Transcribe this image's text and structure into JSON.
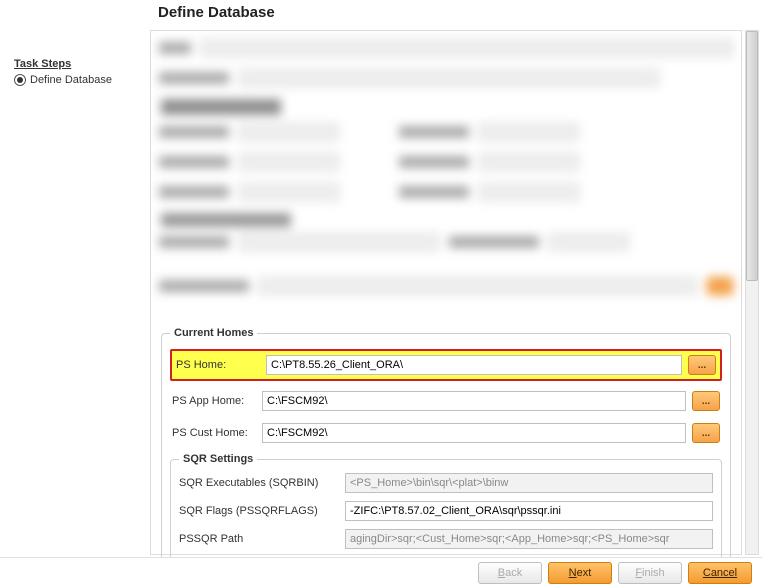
{
  "title": "Define Database",
  "sidebar": {
    "heading": "Task Steps",
    "items": [
      "Define Database"
    ],
    "selected": 0
  },
  "current_homes": {
    "legend": "Current Homes",
    "ps_home": {
      "label": "PS Home:",
      "value": "C:\\PT8.55.26_Client_ORA\\"
    },
    "ps_app_home": {
      "label": "PS App Home:",
      "value": "C:\\FSCM92\\"
    },
    "ps_cust_home": {
      "label": "PS Cust Home:",
      "value": "C:\\FSCM92\\"
    },
    "browse_label": "..."
  },
  "sqr": {
    "legend": "SQR Settings",
    "exec": {
      "label": "SQR Executables (SQRBIN)",
      "value": "<PS_Home>\\bin\\sqr\\<plat>\\binw"
    },
    "flags": {
      "label": "SQR Flags (PSSQRFLAGS)",
      "value": "-ZIFC:\\PT8.57.02_Client_ORA\\sqr\\pssqr.ini"
    },
    "path": {
      "label": "PSSQR Path",
      "value": "agingDir>sqr;<Cust_Home>sqr;<App_Home>sqr;<PS_Home>sqr"
    }
  },
  "footer": {
    "back": "Back",
    "next": "Next",
    "finish": "Finish",
    "cancel": "Cancel"
  }
}
